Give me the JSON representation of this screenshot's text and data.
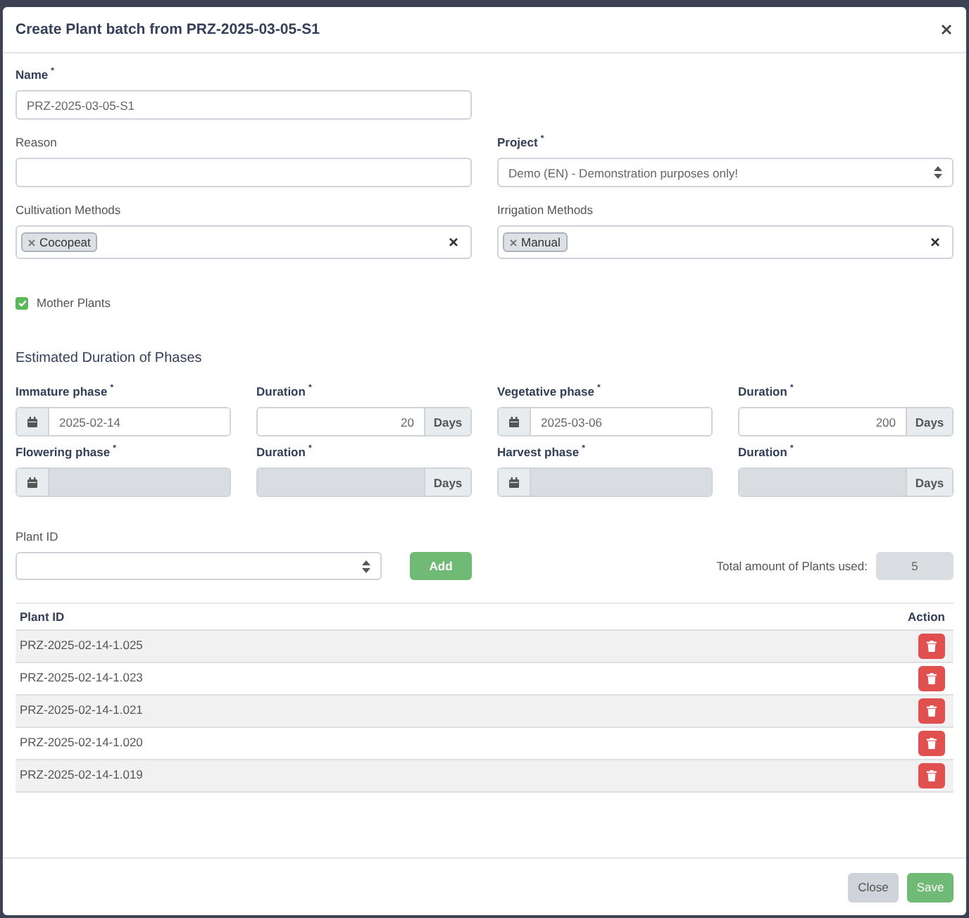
{
  "dialog": {
    "title": "Create Plant batch from PRZ-2025-03-05-S1"
  },
  "name_field": {
    "label": "Name",
    "required_mark": "*",
    "value": "PRZ-2025-03-05-S1"
  },
  "reason_field": {
    "label": "Reason"
  },
  "project_select": {
    "label": "Project",
    "required_mark": "*",
    "value": "Demo (EN) - Demonstration purposes only!"
  },
  "cultivation_methods": {
    "label": "Cultivation Methods",
    "tags": [
      "Cocopeat"
    ]
  },
  "irrigation_methods": {
    "label": "Irrigation Methods",
    "tags": [
      "Manual"
    ]
  },
  "mother_plants": {
    "label": "Mother Plants",
    "checked": true
  },
  "phases_heading": "Estimated Duration of Phases",
  "phases": [
    {
      "label": "Immature phase",
      "required_mark": "*",
      "date": "2025-02-14",
      "duration_label": "Duration",
      "duration_required_mark": "*",
      "duration": "20",
      "unit": "Days",
      "disabled": false
    },
    {
      "label": "Vegetative phase",
      "required_mark": "*",
      "date": "2025-03-06",
      "duration_label": "Duration",
      "duration_required_mark": "*",
      "duration": "200",
      "unit": "Days",
      "disabled": false
    },
    {
      "label": "Flowering phase",
      "required_mark": "*",
      "duration_label": "Duration",
      "duration_required_mark": "*",
      "unit": "Days",
      "disabled": true
    },
    {
      "label": "Harvest phase",
      "required_mark": "*",
      "duration_label": "Duration",
      "duration_required_mark": "*",
      "unit": "Days",
      "disabled": true
    }
  ],
  "plant_id_select": {
    "label": "Plant ID"
  },
  "add_button": "Add",
  "total": {
    "label": "Total amount of Plants used:",
    "value": "5"
  },
  "table": {
    "columns": [
      "Plant ID",
      "Action"
    ],
    "rows": [
      {
        "plant_id": "PRZ-2025-02-14-1.025"
      },
      {
        "plant_id": "PRZ-2025-02-14-1.023"
      },
      {
        "plant_id": "PRZ-2025-02-14-1.021"
      },
      {
        "plant_id": "PRZ-2025-02-14-1.020"
      },
      {
        "plant_id": "PRZ-2025-02-14-1.019"
      }
    ]
  },
  "footer_buttons": [
    {
      "label": "Close",
      "kind": "secondary"
    },
    {
      "label": "Save",
      "kind": "primary"
    }
  ]
}
